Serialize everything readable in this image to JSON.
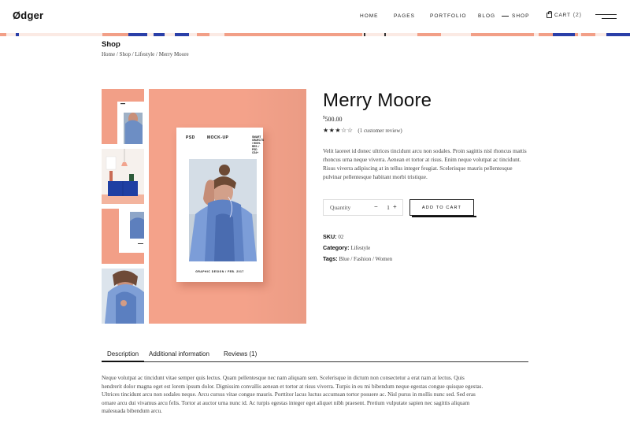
{
  "header": {
    "logo": "Ødger",
    "nav": [
      {
        "label": "HOME"
      },
      {
        "label": "PAGES"
      },
      {
        "label": "PORTFOLIO"
      },
      {
        "label": "BLOG"
      },
      {
        "label": "SHOP"
      }
    ],
    "cart_label": "CART",
    "cart_count": "(2)"
  },
  "page": {
    "title": "Shop",
    "breadcrumb": "Home / Shop / Lifestyle / Merry Moore"
  },
  "poster": {
    "psd": "PSD",
    "mockup": "MOCK-UP",
    "side_text": "SMART OBJECTS / HIGH-RES. / PSD CS4+",
    "footer": "GRAPHIC DESIGN / FEB. 2017"
  },
  "product": {
    "title": "Merry Moore",
    "currency": "$",
    "price": "500.00",
    "stars": "★★★☆☆",
    "review_link": "(1 customer review)",
    "description": "Velit laoreet id donec ultrices tincidunt arcu non sodales. Proin sagittis nisl rhoncus mattis rhoncus urna neque viverra. Aenean et tortor at risus. Enim neque volutpat ac tincidunt. Risus viverra adipiscing at in tellus integer feugiat. Scelerisque mauris pellentesque pulvinar pellentesque habitant morbi tristique.",
    "quantity_label": "Quantity",
    "quantity_minus": "−",
    "quantity_value": "1",
    "quantity_plus": "+",
    "add_to_cart": "ADD TO CART",
    "sku_label": "SKU:",
    "sku_value": "02",
    "category_label": "Category:",
    "category_value": "Lifestyle",
    "tags_label": "Tags:",
    "tags_value": "Blue / Fashion / Women"
  },
  "tabs": {
    "items": [
      {
        "label": "Description"
      },
      {
        "label": "Additional information"
      },
      {
        "label": "Reviews (1)"
      }
    ],
    "content": "Neque volutpat ac tincidunt vitae semper quis lectus. Quam pellentesque nec nam aliquam sem. Scelerisque in dictum non consectetur a erat nam at lectus. Quis hendrerit dolor magna eget est lorem ipsum dolor. Dignissim convallis aenean et tortor at risus viverra. Turpis in eu mi bibendum neque egestas congue quisque egestas. Ultrices tincidunt arcu non sodales neque. Arcu cursus vitae congue mauris. Porttitor lacus luctus accumsan tortor posuere ac. Nisl purus in mollis nunc sed. Sed eras ornare arcu dui vivamus arcu felis. Tortor at auctor urna nunc id. Ac turpis egestas integer eget aliquet nibh praesent. Pretium vulputate sapien nec sagittis aliquam malesuada bibendum arcu."
  },
  "colors": {
    "accent_salmon": "#f4a28a",
    "band_blue": "#2a3fa8",
    "text_dark": "#111111"
  }
}
